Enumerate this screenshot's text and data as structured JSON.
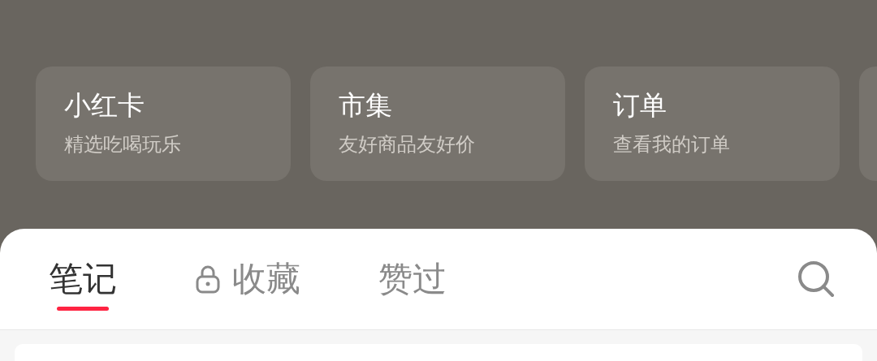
{
  "shortcuts": [
    {
      "kind": "full",
      "title": "小红卡",
      "subtitle": "精选吃喝玩乐"
    },
    {
      "kind": "full",
      "title": "市集",
      "subtitle": "友好商品友好价"
    },
    {
      "kind": "full",
      "title": "订单",
      "subtitle": "查看我的订单"
    },
    {
      "kind": "partial"
    }
  ],
  "tabs": [
    {
      "label": "笔记",
      "selected": true,
      "locked": false
    },
    {
      "label": "收藏",
      "selected": false,
      "locked": true
    },
    {
      "label": "赞过",
      "selected": false,
      "locked": false
    }
  ]
}
